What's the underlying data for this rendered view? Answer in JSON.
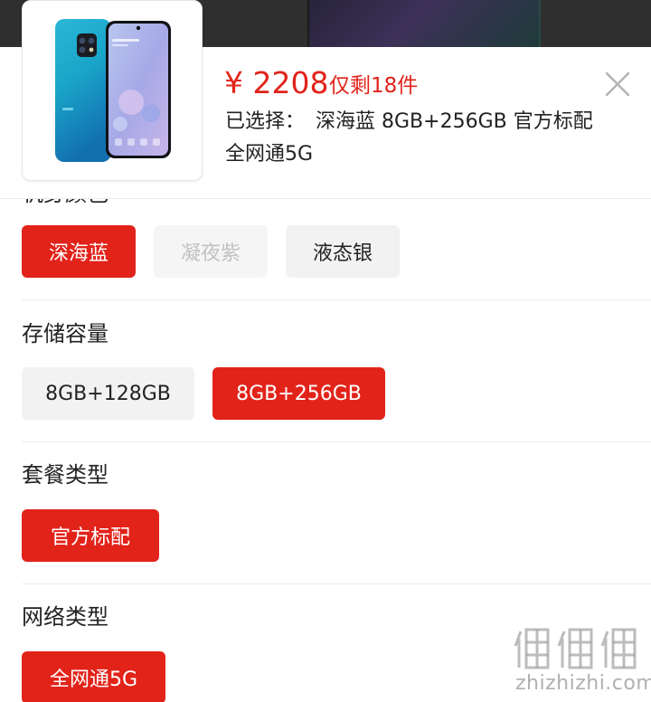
{
  "product": {
    "price": "¥ 2208",
    "stock": "仅剩18件",
    "selected_label": "已选择：",
    "selected_value_line1": "深海蓝 8GB+256GB 官方标配",
    "selected_value_line2": "全网通5G",
    "image_icon": "phone-product-image"
  },
  "colors": {
    "accent": "#e2231a",
    "chip_bg": "#f2f2f2",
    "disabled_text": "#c2c2c2"
  },
  "sections": {
    "color": {
      "title": "机身颜色",
      "options": [
        {
          "label": "深海蓝",
          "state": "selected"
        },
        {
          "label": "凝夜紫",
          "state": "disabled"
        },
        {
          "label": "液态银",
          "state": "available"
        }
      ]
    },
    "storage": {
      "title": "存储容量",
      "options": [
        {
          "label": "8GB+128GB",
          "state": "available"
        },
        {
          "label": "8GB+256GB",
          "state": "selected"
        }
      ]
    },
    "package": {
      "title": "套餐类型",
      "options": [
        {
          "label": "官方标配",
          "state": "selected"
        }
      ]
    },
    "network": {
      "title": "网络类型",
      "options": [
        {
          "label": "全网通5G",
          "state": "selected"
        }
      ]
    }
  },
  "close_icon": "close-icon",
  "watermark": {
    "logo_text": "值值值",
    "site": "zhizhizhi.com"
  }
}
